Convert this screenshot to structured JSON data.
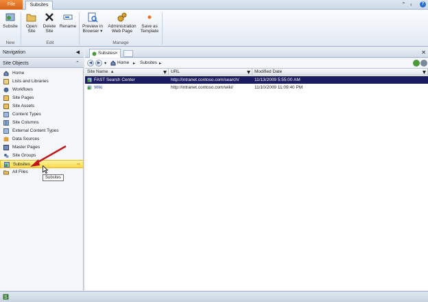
{
  "tabs": {
    "file": "File",
    "subsites": "Subsites"
  },
  "ribbon": {
    "new_group": "New",
    "edit_group": "Edit",
    "manage_group": "Manage",
    "subsite": "Subsite",
    "open_site_1": "Open",
    "open_site_2": "Site",
    "delete_site_1": "Delete",
    "delete_site_2": "Site",
    "rename": "Rename",
    "preview_1": "Preview in",
    "preview_2": "Browser",
    "admin_1": "Administration",
    "admin_2": "Web Page",
    "save_tpl_1": "Save as",
    "save_tpl_2": "Template"
  },
  "nav": {
    "title": "Navigation",
    "site_objects": "Site Objects",
    "items": [
      {
        "label": "Home",
        "icon": "home-icon"
      },
      {
        "label": "Lists and Libraries",
        "icon": "list-icon"
      },
      {
        "label": "Workflows",
        "icon": "workflow-icon"
      },
      {
        "label": "Site Pages",
        "icon": "pages-icon"
      },
      {
        "label": "Site Assets",
        "icon": "assets-icon"
      },
      {
        "label": "Content Types",
        "icon": "content-types-icon"
      },
      {
        "label": "Site Columns",
        "icon": "columns-icon"
      },
      {
        "label": "External Content Types",
        "icon": "external-content-icon"
      },
      {
        "label": "Data Sources",
        "icon": "database-icon"
      },
      {
        "label": "Master Pages",
        "icon": "master-pages-icon"
      },
      {
        "label": "Site Groups",
        "icon": "groups-icon"
      },
      {
        "label": "Subsites",
        "icon": "subsites-icon"
      },
      {
        "label": "All Files",
        "icon": "folder-icon"
      }
    ],
    "selected_index": 11,
    "tooltip": "Subsites"
  },
  "document": {
    "tab_label": "Subsites",
    "breadcrumb": [
      "Home",
      "Subsites"
    ]
  },
  "grid": {
    "columns": [
      "Site Name",
      "URL",
      "Modified Date"
    ],
    "rows": [
      {
        "name": "FAST Search Center",
        "url": "http://intranet.contoso.com/search/",
        "modified": "11/13/2009 5:55:00 AM",
        "selected": true
      },
      {
        "name": "Wiki",
        "url": "http://intranet.contoso.com/wiki/",
        "modified": "11/10/2009 11:09:40 PM",
        "selected": false
      }
    ]
  },
  "colors": {
    "selected_row": "#1b1b5f",
    "file_tab": "#e0702a",
    "selected_nav": "#ffe46a",
    "annotation_arrow": "#c0161c"
  }
}
